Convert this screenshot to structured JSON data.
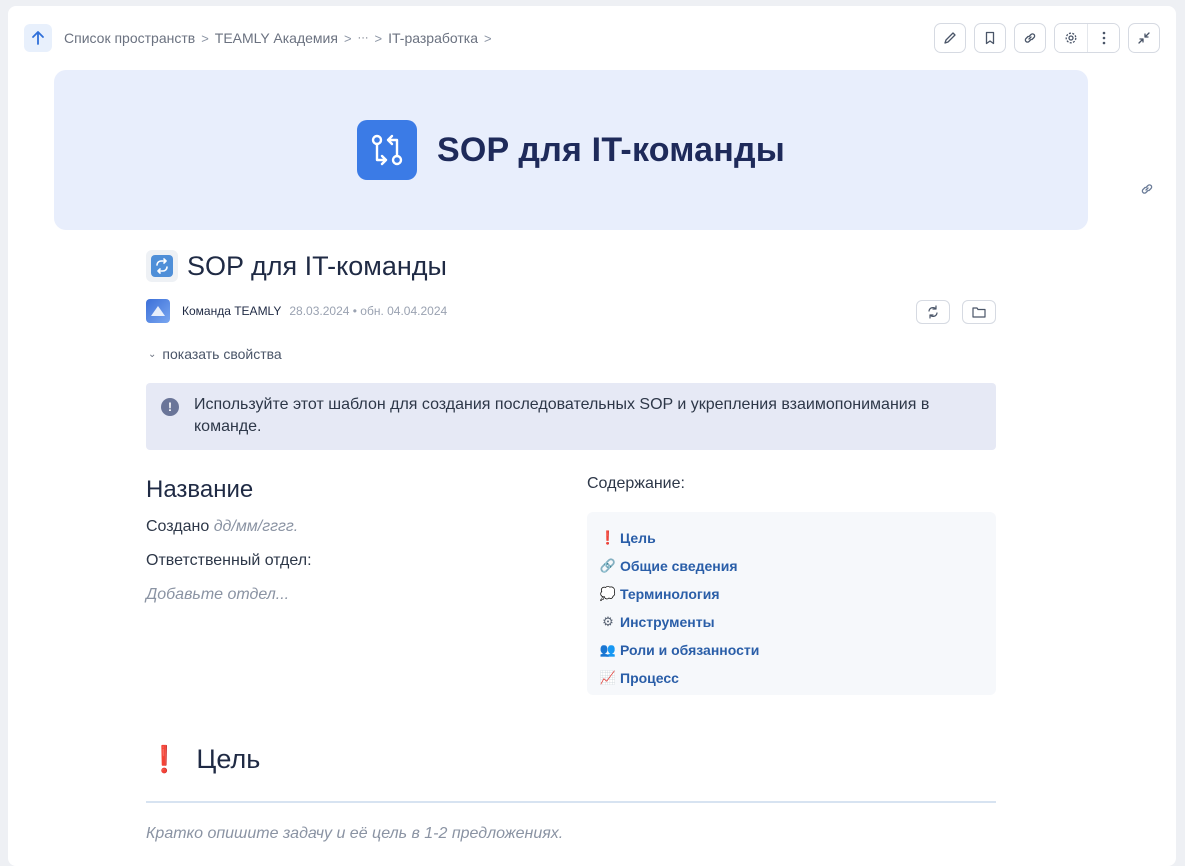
{
  "breadcrumb": {
    "items": [
      "Список пространств",
      "TEAMLY Академия",
      "···",
      "IT-разработка"
    ],
    "separator": ">"
  },
  "toolbar": {
    "icons": [
      "pencil-icon",
      "bookmark-icon",
      "link-icon",
      "gear-icon",
      "more-vertical-icon",
      "collapse-icon"
    ]
  },
  "cover": {
    "title": "SOP для IT-команды",
    "accent": "#3b7be6",
    "background": "#e8eefc"
  },
  "page": {
    "title": "SOP для IT-команды",
    "author": "Команда TEAMLY",
    "dates": "28.03.2024 • обн. 04.04.2024",
    "show_properties": "показать свойства"
  },
  "callout": {
    "text": "Используйте этот шаблон для создания последовательных SOP и укрепления взаимопонимания в команде."
  },
  "info_block": {
    "heading": "Название",
    "created_label": "Создано",
    "created_placeholder": "дд/мм/гггг.",
    "dept_label": "Ответственный отдел:",
    "dept_placeholder": "Добавьте отдел..."
  },
  "toc": {
    "heading": "Содержание:",
    "items": [
      {
        "emoji": "❗",
        "label": "Цель"
      },
      {
        "emoji": "🔗",
        "label": "Общие сведения"
      },
      {
        "emoji": "💭",
        "label": "Терминология"
      },
      {
        "emoji": "⚙",
        "label": "Инструменты"
      },
      {
        "emoji": "👥",
        "label": "Роли и обязанности"
      },
      {
        "emoji": "📈",
        "label": "Процесс"
      }
    ]
  },
  "goal": {
    "emoji": "❗",
    "heading": "Цель",
    "placeholder": "Кратко опишите задачу и её цель в 1-2 предложениях."
  }
}
